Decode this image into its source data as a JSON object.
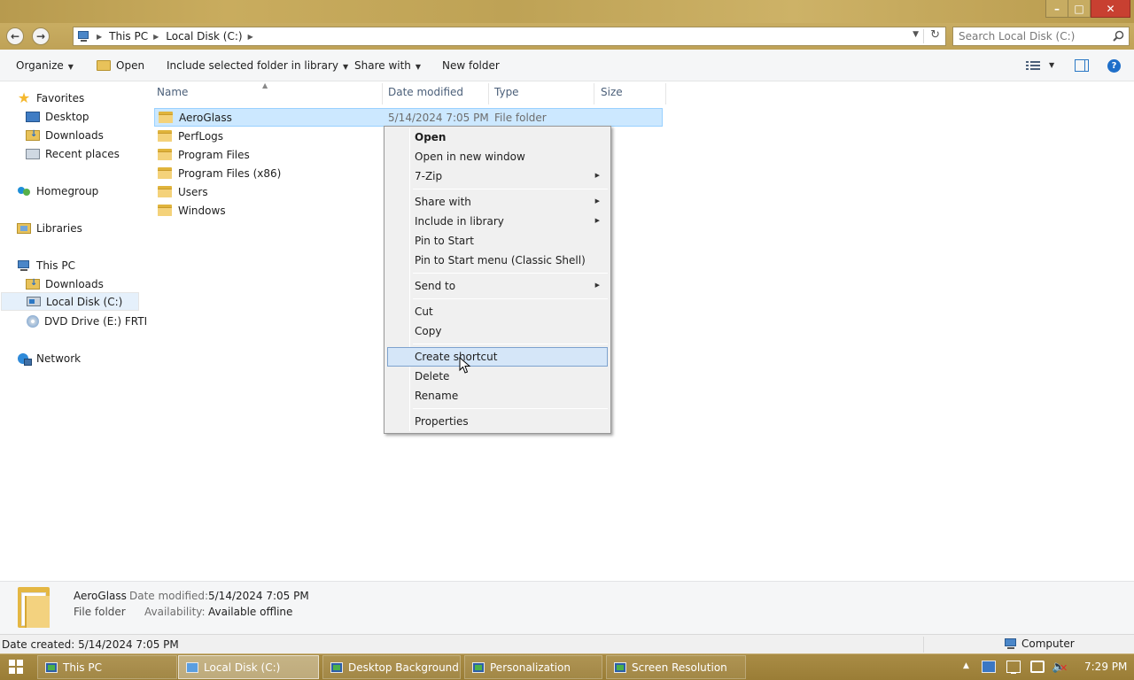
{
  "window": {
    "controls": {
      "minimize": "–",
      "maximize": "□",
      "close": "✕"
    }
  },
  "address_bar": {
    "breadcrumbs": [
      "This PC",
      "Local Disk (C:)"
    ],
    "search_placeholder": "Search Local Disk (C:)"
  },
  "command_bar": {
    "organize": "Organize",
    "open": "Open",
    "include_in_library": "Include selected folder in library",
    "share_with": "Share with",
    "new_folder": "New folder",
    "help": "?"
  },
  "nav_pane": {
    "favorites": "Favorites",
    "favorites_items": [
      "Desktop",
      "Downloads",
      "Recent places"
    ],
    "homegroup": "Homegroup",
    "libraries": "Libraries",
    "this_pc": "This PC",
    "this_pc_items": [
      "Downloads",
      "Local Disk (C:)",
      "DVD Drive (E:) FRTM"
    ],
    "network": "Network",
    "selected": "Local Disk (C:)"
  },
  "file_list": {
    "columns": [
      "Name",
      "Date modified",
      "Type",
      "Size"
    ],
    "rows": [
      {
        "name": "AeroGlass",
        "date_modified": "5/14/2024 7:05 PM",
        "type": "File folder",
        "selected": true
      },
      {
        "name": "PerfLogs"
      },
      {
        "name": "Program Files"
      },
      {
        "name": "Program Files (x86)"
      },
      {
        "name": "Users"
      },
      {
        "name": "Windows"
      }
    ]
  },
  "context_menu": {
    "items": [
      "Open",
      "Open in new window",
      "7-Zip",
      "Share with",
      "Include in library",
      "Pin to Start",
      "Pin to Start menu (Classic Shell)",
      "Send to",
      "Cut",
      "Copy",
      "Create shortcut",
      "Delete",
      "Rename",
      "Properties"
    ],
    "highlighted": "Create shortcut",
    "submenu_arrow": "▶"
  },
  "details_pane": {
    "name": "AeroGlass",
    "type": "File folder",
    "date_modified_label": "Date modified:",
    "date_modified_value": "5/14/2024 7:05 PM",
    "availability_label": "Availability:",
    "availability_value": "Available offline"
  },
  "status_bar": {
    "left": "Date created: 5/14/2024 7:05 PM",
    "right": "Computer"
  },
  "taskbar": {
    "items": [
      "This PC",
      "Local Disk (C:)",
      "Desktop Background",
      "Personalization",
      "Screen Resolution"
    ],
    "active": "Local Disk (C:)",
    "clock": "7:29 PM"
  },
  "colors": {
    "title_bar": "#c3a75a",
    "selection": "#cce8ff",
    "menu_highlight": "#d5e6f8",
    "close_button": "#c84031"
  }
}
